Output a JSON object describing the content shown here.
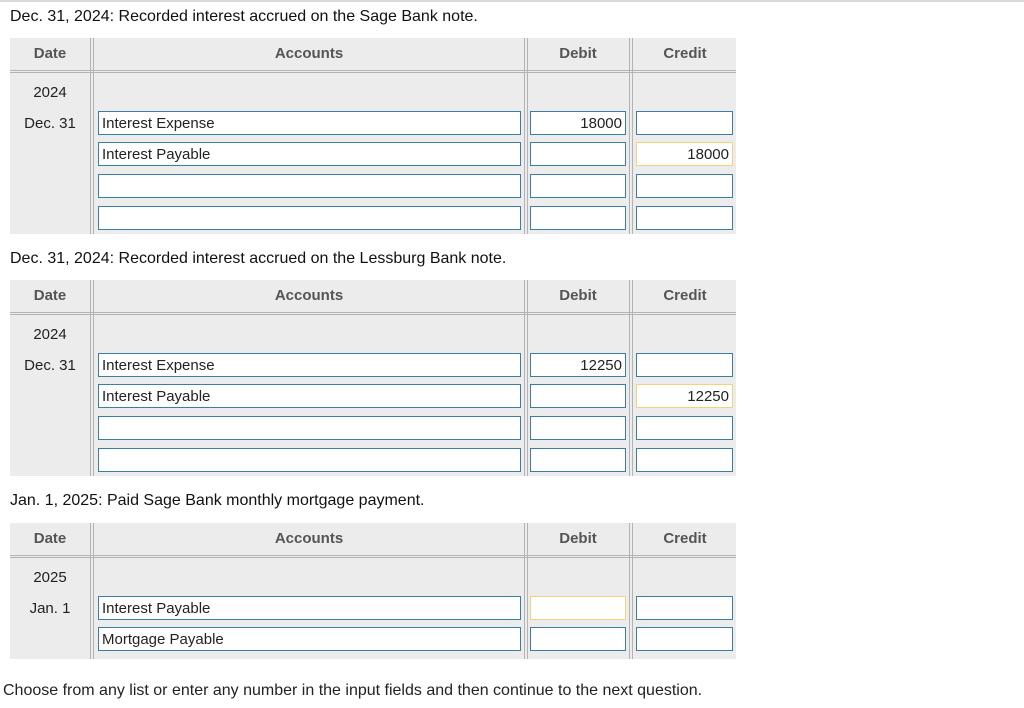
{
  "header_labels": {
    "date": "Date",
    "accounts": "Accounts",
    "debit": "Debit",
    "credit": "Credit"
  },
  "entries": [
    {
      "title": "Dec. 31, 2024: Recorded interest accrued on the Sage Bank note.",
      "year": "2024",
      "day": "Dec. 31",
      "rows": [
        {
          "account": "Interest Expense",
          "debit": "18000",
          "credit": ""
        },
        {
          "account": "Interest Payable",
          "debit": "",
          "credit": "18000"
        },
        {
          "account": "",
          "debit": "",
          "credit": ""
        },
        {
          "account": "",
          "debit": "",
          "credit": ""
        }
      ]
    },
    {
      "title": "Dec. 31, 2024: Recorded interest accrued on the Lessburg Bank note.",
      "year": "2024",
      "day": "Dec. 31",
      "rows": [
        {
          "account": "Interest Expense",
          "debit": "12250",
          "credit": ""
        },
        {
          "account": "Interest Payable",
          "debit": "",
          "credit": "12250"
        },
        {
          "account": "",
          "debit": "",
          "credit": ""
        },
        {
          "account": "",
          "debit": "",
          "credit": ""
        }
      ]
    },
    {
      "title": "Jan. 1, 2025: Paid Sage Bank monthly mortgage payment.",
      "year": "2025",
      "day": "Jan. 1",
      "rows": [
        {
          "account": "Interest Payable",
          "debit": "",
          "credit": ""
        },
        {
          "account": "Mortgage Payable",
          "debit": "",
          "credit": ""
        }
      ]
    }
  ],
  "footer": "Choose from any list or enter any number in the input fields and then continue to the next question."
}
